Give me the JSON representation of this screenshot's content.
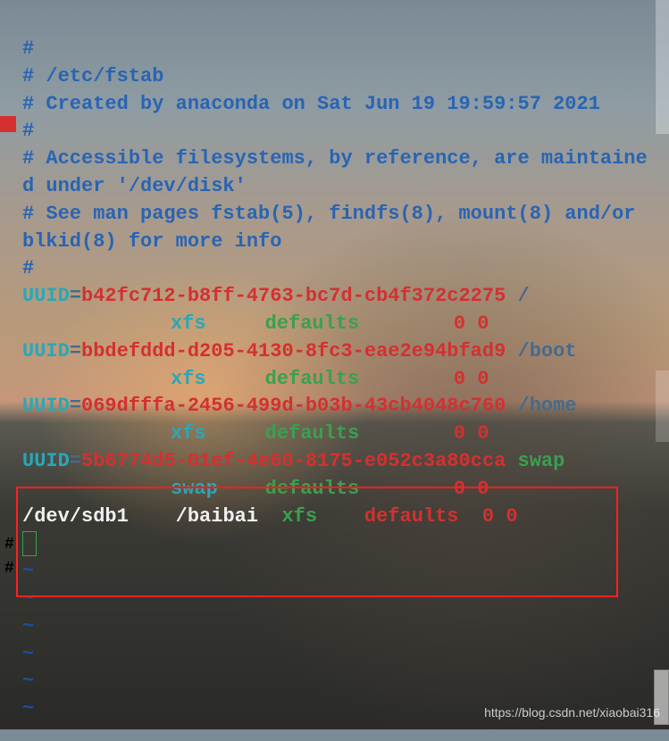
{
  "comments": {
    "c1": "#",
    "c2": "# /etc/fstab",
    "c3": "# Created by anaconda on Sat Jun 19 19:59:57 2021",
    "c4": "#",
    "c5": "# Accessible filesystems, by reference, are maintained under '/dev/disk'",
    "c6": "# See man pages fstab(5), findfs(8), mount(8) and/or blkid(8) for more info",
    "c7": "#"
  },
  "entries": [
    {
      "key": "UUID",
      "eq": "=",
      "uuid": "b42fc712-b8ff-4763-bc7d-cb4f372c2275",
      "mount": " /",
      "fs": "xfs",
      "opts": "defaults",
      "dump": "0 0"
    },
    {
      "key": "UUID",
      "eq": "=",
      "uuid": "bbdefddd-d205-4130-8fc3-eae2e94bfad9",
      "mount": " /boot",
      "fs": "xfs",
      "opts": "defaults",
      "dump": "0 0"
    },
    {
      "key": "UUID",
      "eq": "=",
      "uuid": "069dfffa-2456-499d-b03b-43cb4048c760",
      "mount": " /home",
      "fs": "xfs",
      "opts": "defaults",
      "dump": "0 0"
    },
    {
      "key": "UUID",
      "eq": "=",
      "uuid": "5b6774d5-01ef-4e60-8175-e052c3a80cca",
      "mount": " swap",
      "fs": "swap",
      "opts": "defaults",
      "dump": "0 0"
    }
  ],
  "custom": {
    "dev": "/dev/sdb1",
    "mount": "/baibai",
    "fs": "xfs",
    "opts": "defaults",
    "dump": "0 0"
  },
  "tilde": "~",
  "watermark": "https://blog.csdn.net/xiaobai316",
  "sidebar": {
    "s1": "#",
    "s2": "#"
  }
}
